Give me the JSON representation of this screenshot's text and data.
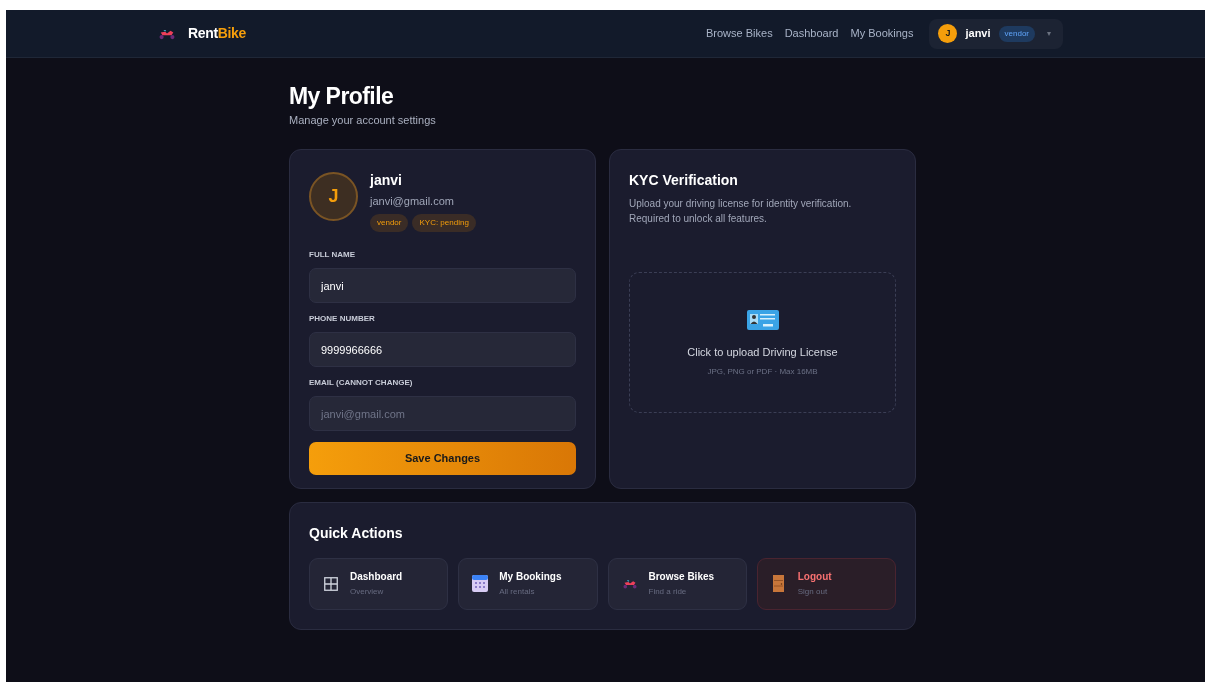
{
  "nav": {
    "brand_first": "Rent",
    "brand_second": "Bike",
    "links": [
      "Browse Bikes",
      "Dashboard",
      "My Bookings"
    ],
    "user": {
      "initial": "J",
      "name": "janvi",
      "role": "vendor",
      "caret": "▾"
    }
  },
  "page": {
    "title": "My Profile",
    "subtitle": "Manage your account settings"
  },
  "profile": {
    "initial": "J",
    "name": "janvi",
    "email": "janvi@gmail.com",
    "badges": [
      "vendor",
      "KYC: pending"
    ],
    "fields": [
      {
        "label": "FULL NAME",
        "value": "janvi",
        "disabled": false
      },
      {
        "label": "PHONE NUMBER",
        "value": "9999966666",
        "disabled": false
      },
      {
        "label": "EMAIL (CANNOT CHANGE)",
        "value": "janvi@gmail.com",
        "disabled": true
      }
    ],
    "save_button": "Save Changes"
  },
  "kyc": {
    "title": "KYC Verification",
    "description": "Upload your driving license for identity verification. Required to unlock all features.",
    "upload_label": "Click to upload Driving License",
    "upload_hint": "JPG, PNG or PDF · Max 16MB"
  },
  "quick_actions": {
    "title": "Quick Actions",
    "items": [
      {
        "kind": "grid",
        "title": "Dashboard",
        "subtitle": "Overview",
        "danger": false
      },
      {
        "kind": "calendar",
        "title": "My Bookings",
        "subtitle": "All rentals",
        "danger": false
      },
      {
        "kind": "bike",
        "title": "Browse Bikes",
        "subtitle": "Find a ride",
        "danger": false
      },
      {
        "kind": "door",
        "title": "Logout",
        "subtitle": "Sign out",
        "danger": true
      }
    ]
  }
}
